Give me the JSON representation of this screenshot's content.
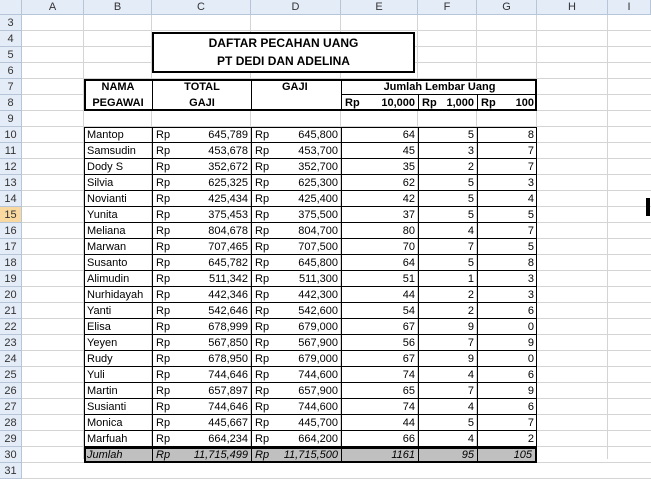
{
  "columns": [
    "A",
    "B",
    "C",
    "D",
    "E",
    "F",
    "G",
    "H",
    "I"
  ],
  "selected_row": "15",
  "row_numbers": [
    "3",
    "4",
    "5",
    "6",
    "7",
    "8",
    "9",
    "10",
    "11",
    "12",
    "13",
    "14",
    "15",
    "16",
    "17",
    "18",
    "19",
    "20",
    "21",
    "22",
    "23",
    "24",
    "25",
    "26",
    "27",
    "28",
    "29",
    "30",
    "31"
  ],
  "title": {
    "line1": "DAFTAR PECAHAN UANG",
    "line2": "PT DEDI DAN ADELINA"
  },
  "headers": {
    "nama_1": "NAMA",
    "nama_2": "PEGAWAI",
    "total_1": "TOTAL",
    "total_2": "GAJI",
    "gaji": "GAJI",
    "jumlah_lembar": "Jumlah Lembar Uang",
    "rp": "Rp",
    "denom_1": "10,000",
    "denom_2": "1,000",
    "denom_3": "100"
  },
  "currency": "Rp",
  "rows": [
    {
      "name": "Mantop",
      "total": "645,789",
      "gaji": "645,800",
      "n10000": "64",
      "n1000": "5",
      "n100": "8"
    },
    {
      "name": "Samsudin",
      "total": "453,678",
      "gaji": "453,700",
      "n10000": "45",
      "n1000": "3",
      "n100": "7"
    },
    {
      "name": "Dody S",
      "total": "352,672",
      "gaji": "352,700",
      "n10000": "35",
      "n1000": "2",
      "n100": "7"
    },
    {
      "name": "Silvia",
      "total": "625,325",
      "gaji": "625,300",
      "n10000": "62",
      "n1000": "5",
      "n100": "3"
    },
    {
      "name": "Novianti",
      "total": "425,434",
      "gaji": "425,400",
      "n10000": "42",
      "n1000": "5",
      "n100": "4"
    },
    {
      "name": "Yunita",
      "total": "375,453",
      "gaji": "375,500",
      "n10000": "37",
      "n1000": "5",
      "n100": "5"
    },
    {
      "name": "Meliana",
      "total": "804,678",
      "gaji": "804,700",
      "n10000": "80",
      "n1000": "4",
      "n100": "7"
    },
    {
      "name": "Marwan",
      "total": "707,465",
      "gaji": "707,500",
      "n10000": "70",
      "n1000": "7",
      "n100": "5"
    },
    {
      "name": "Susanto",
      "total": "645,782",
      "gaji": "645,800",
      "n10000": "64",
      "n1000": "5",
      "n100": "8"
    },
    {
      "name": "Alimudin",
      "total": "511,342",
      "gaji": "511,300",
      "n10000": "51",
      "n1000": "1",
      "n100": "3"
    },
    {
      "name": "Nurhidayah",
      "total": "442,346",
      "gaji": "442,300",
      "n10000": "44",
      "n1000": "2",
      "n100": "3"
    },
    {
      "name": "Yanti",
      "total": "542,646",
      "gaji": "542,600",
      "n10000": "54",
      "n1000": "2",
      "n100": "6"
    },
    {
      "name": "Elisa",
      "total": "678,999",
      "gaji": "679,000",
      "n10000": "67",
      "n1000": "9",
      "n100": "0"
    },
    {
      "name": "Yeyen",
      "total": "567,850",
      "gaji": "567,900",
      "n10000": "56",
      "n1000": "7",
      "n100": "9"
    },
    {
      "name": "Rudy",
      "total": "678,950",
      "gaji": "679,000",
      "n10000": "67",
      "n1000": "9",
      "n100": "0"
    },
    {
      "name": "Yuli",
      "total": "744,646",
      "gaji": "744,600",
      "n10000": "74",
      "n1000": "4",
      "n100": "6"
    },
    {
      "name": "Martin",
      "total": "657,897",
      "gaji": "657,900",
      "n10000": "65",
      "n1000": "7",
      "n100": "9"
    },
    {
      "name": "Susianti",
      "total": "744,646",
      "gaji": "744,600",
      "n10000": "74",
      "n1000": "4",
      "n100": "6"
    },
    {
      "name": "Monica",
      "total": "445,667",
      "gaji": "445,700",
      "n10000": "44",
      "n1000": "5",
      "n100": "7"
    },
    {
      "name": "Marfuah",
      "total": "664,234",
      "gaji": "664,200",
      "n10000": "66",
      "n1000": "4",
      "n100": "2"
    }
  ],
  "summary": {
    "label": "Jumlah",
    "total": "11,715,499",
    "gaji": "11,715,500",
    "n10000": "1161",
    "n1000": "95",
    "n100": "105"
  }
}
